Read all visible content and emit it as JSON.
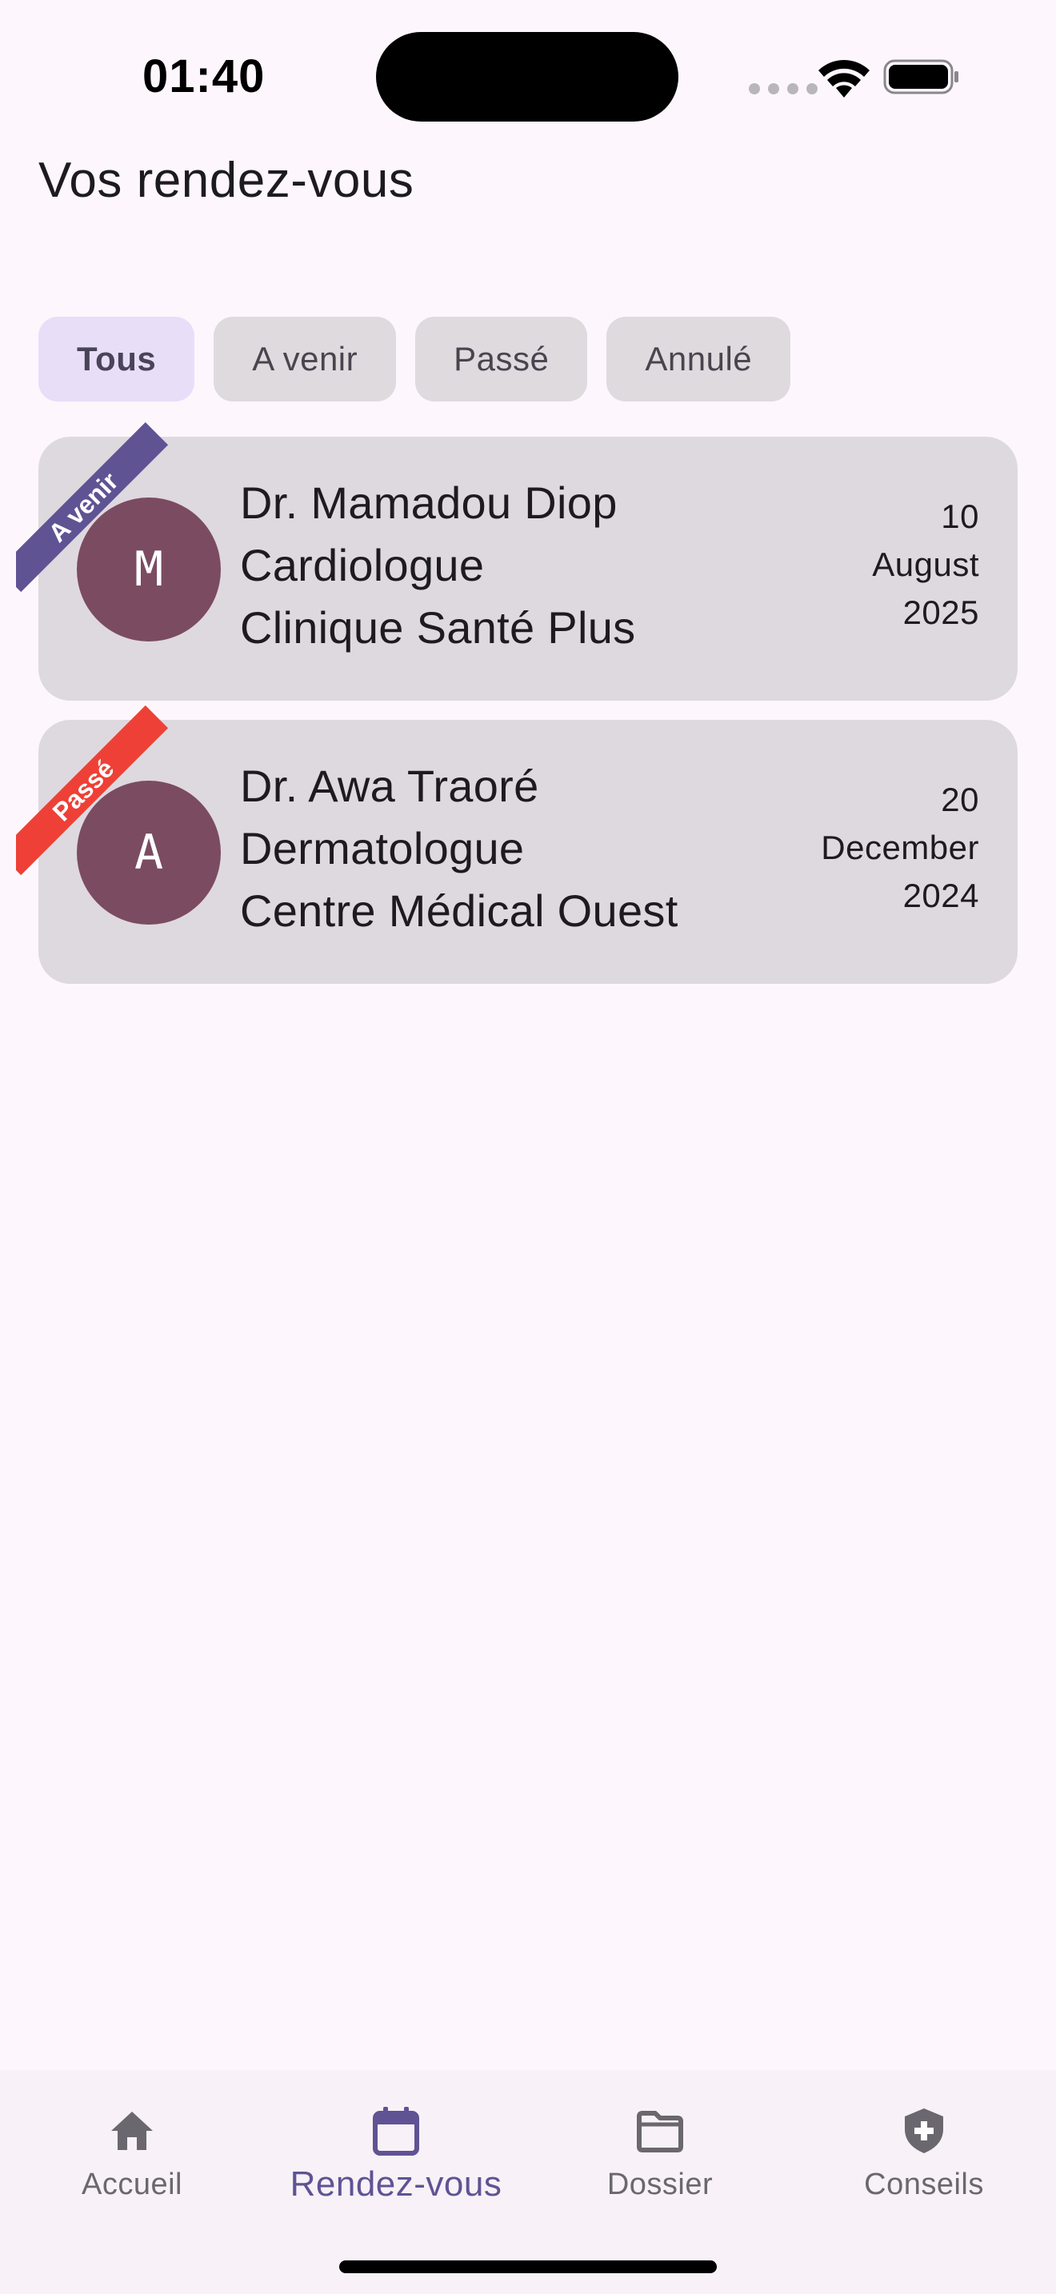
{
  "status_bar": {
    "time": "01:40"
  },
  "header": {
    "title": "Vos rendez-vous"
  },
  "filters": [
    {
      "label": "Tous",
      "active": true
    },
    {
      "label": "A venir",
      "active": false
    },
    {
      "label": "Passé",
      "active": false
    },
    {
      "label": "Annulé",
      "active": false
    }
  ],
  "appointments": [
    {
      "status": "A venir",
      "avatar_initial": "M",
      "doctor": "Dr. Mamadou Diop",
      "specialty": "Cardiologue",
      "clinic": "Clinique Santé Plus",
      "date_day": "10",
      "date_month": "August",
      "date_year": "2025"
    },
    {
      "status": "Passé",
      "avatar_initial": "A",
      "doctor": "Dr. Awa Traoré",
      "specialty": "Dermatologue",
      "clinic": "Centre Médical Ouest",
      "date_day": "20",
      "date_month": "December",
      "date_year": "2024"
    }
  ],
  "bottom_nav": {
    "items": [
      {
        "label": "Accueil",
        "icon": "home-icon",
        "active": false
      },
      {
        "label": "Rendez-vous",
        "icon": "calendar-icon",
        "active": true
      },
      {
        "label": "Dossier",
        "icon": "folder-icon",
        "active": false
      },
      {
        "label": "Conseils",
        "icon": "shield-plus-icon",
        "active": false
      }
    ]
  },
  "colors": {
    "background": "#fdf7fd",
    "card": "#ded9de",
    "accent": "#5f5394",
    "ribbon_upcoming": "#5f5394",
    "ribbon_past": "#ee4036",
    "avatar": "#7b4b62",
    "chip_active": "#e8def8"
  }
}
